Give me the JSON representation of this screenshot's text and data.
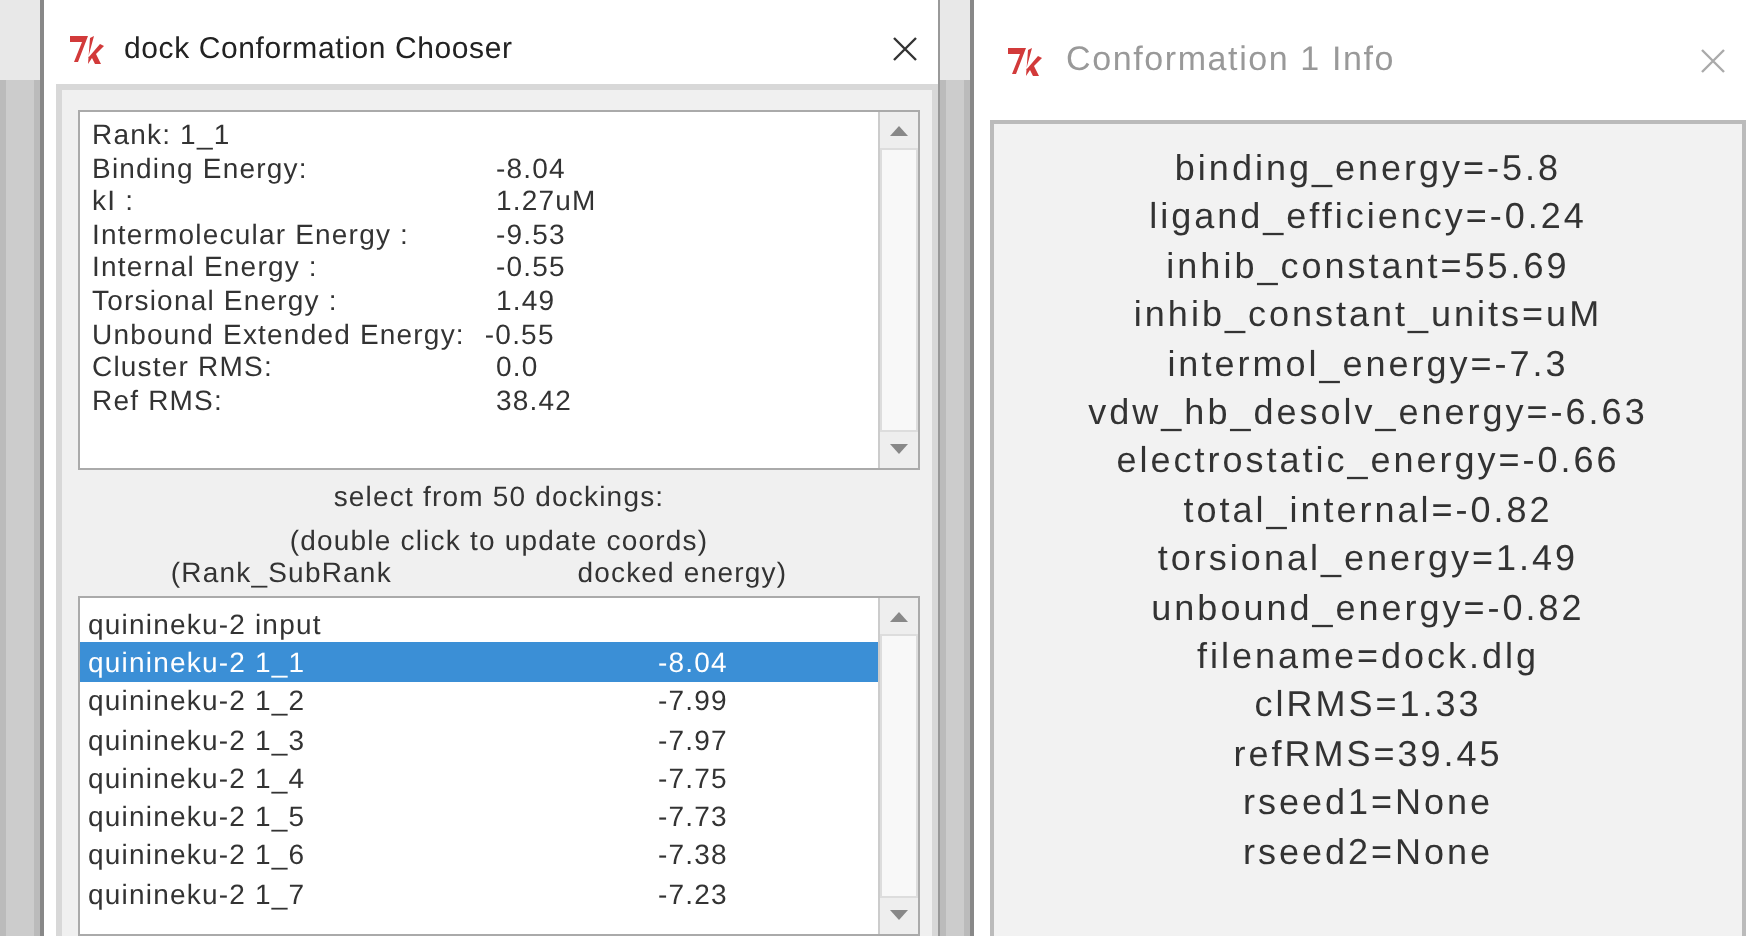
{
  "chooser": {
    "title": "dock Conformation Chooser",
    "active": true,
    "details": [
      {
        "kind": "text",
        "label": "Rank: 1_1"
      },
      {
        "kind": "column",
        "label": "Binding Energy:",
        "value": "-8.04"
      },
      {
        "kind": "column",
        "label": "kI :",
        "value": "1.27uM"
      },
      {
        "kind": "column",
        "label": "Intermolecular Energy :",
        "value": "-9.53"
      },
      {
        "kind": "column",
        "label": "Internal Energy :",
        "value": "-0.55"
      },
      {
        "kind": "column",
        "label": "Torsional Energy :",
        "value": "1.49"
      },
      {
        "kind": "inline",
        "label": "Unbound Extended Energy:",
        "value": "-0.55"
      },
      {
        "kind": "column",
        "label": "Cluster RMS:",
        "value": "0.0"
      },
      {
        "kind": "column",
        "label": "Ref RMS:",
        "value": "38.42"
      }
    ],
    "captions": [
      "select from 50 dockings:",
      "(double click to update coords)"
    ],
    "columns": [
      "(Rank_SubRank",
      "docked energy)"
    ],
    "rows": [
      {
        "name": "quinineku-2 input",
        "selected": false
      },
      {
        "name": "quinineku-2 1_1",
        "energy": "-8.04",
        "selected": true
      },
      {
        "name": "quinineku-2 1_2",
        "energy": "-7.99",
        "selected": false
      },
      {
        "name": "quinineku-2 1_3",
        "energy": "-7.97",
        "selected": false
      },
      {
        "name": "quinineku-2 1_4",
        "energy": "-7.75",
        "selected": false
      },
      {
        "name": "quinineku-2 1_5",
        "energy": "-7.73",
        "selected": false
      },
      {
        "name": "quinineku-2 1_6",
        "energy": "-7.38",
        "selected": false
      },
      {
        "name": "quinineku-2 1_7",
        "energy": "-7.23",
        "selected": false
      }
    ]
  },
  "info": {
    "title": "Conformation 1 Info",
    "active": false,
    "lines": [
      "binding_energy=-5.8",
      "ligand_efficiency=-0.24",
      "inhib_constant=55.69",
      "inhib_constant_units=uM",
      "intermol_energy=-7.3",
      "vdw_hb_desolv_energy=-6.63",
      "electrostatic_energy=-0.66",
      "total_internal=-0.82",
      "torsional_energy=1.49",
      "unbound_energy=-0.82",
      "filename=dock.dlg",
      "clRMS=1.33",
      "refRMS=39.45",
      "rseed1=None",
      "rseed2=None"
    ]
  }
}
